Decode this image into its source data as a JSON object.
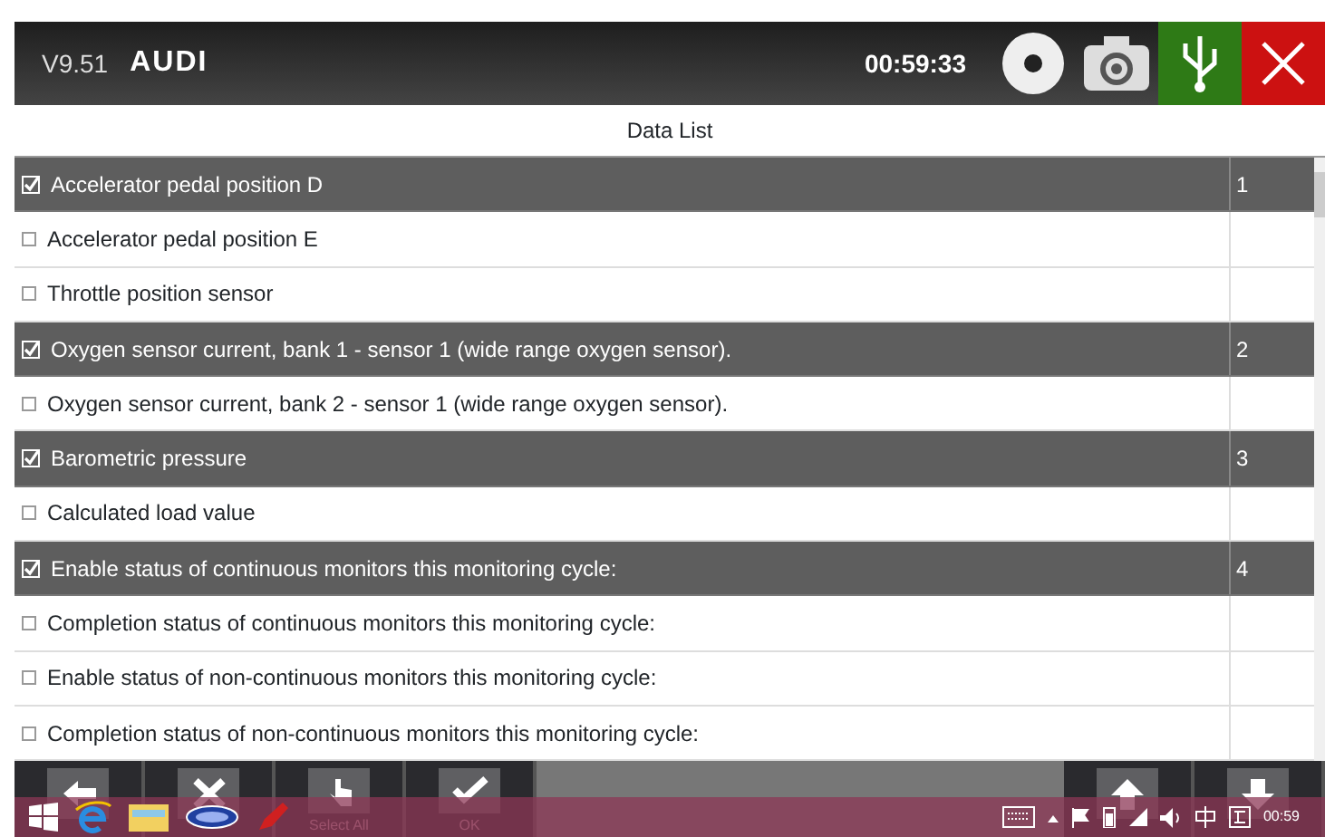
{
  "header": {
    "version": "V9.51",
    "brand": "AUDI",
    "time": "00:59:33"
  },
  "title": "Data List",
  "rows": [
    {
      "label": "Accelerator pedal position D",
      "checked": true,
      "order": "1"
    },
    {
      "label": "Accelerator pedal position E",
      "checked": false
    },
    {
      "label": "Throttle position sensor",
      "checked": false
    },
    {
      "label": "Oxygen sensor current, bank 1 - sensor 1 (wide range oxygen sensor).",
      "checked": true,
      "order": "2"
    },
    {
      "label": "Oxygen sensor current, bank 2 - sensor 1 (wide range oxygen sensor).",
      "checked": false
    },
    {
      "label": "Barometric pressure",
      "checked": true,
      "order": "3"
    },
    {
      "label": "Calculated load value",
      "checked": false
    },
    {
      "label": "Enable status of continuous monitors this monitoring cycle:",
      "checked": true,
      "order": "4"
    },
    {
      "label": "Completion status of continuous monitors this monitoring cycle:",
      "checked": false
    },
    {
      "label": "Enable status of non-continuous monitors this monitoring cycle:",
      "checked": false
    },
    {
      "label": "Completion status of non-continuous monitors this monitoring cycle:",
      "checked": false
    }
  ],
  "toolbar": [
    {
      "kind": "back"
    },
    {
      "kind": "clear"
    },
    {
      "kind": "select",
      "label": "Select All"
    },
    {
      "kind": "ok",
      "label": "OK"
    },
    {
      "kind": "gap"
    },
    {
      "kind": "up"
    },
    {
      "kind": "down"
    }
  ],
  "taskbar": {
    "time": "00:59"
  }
}
